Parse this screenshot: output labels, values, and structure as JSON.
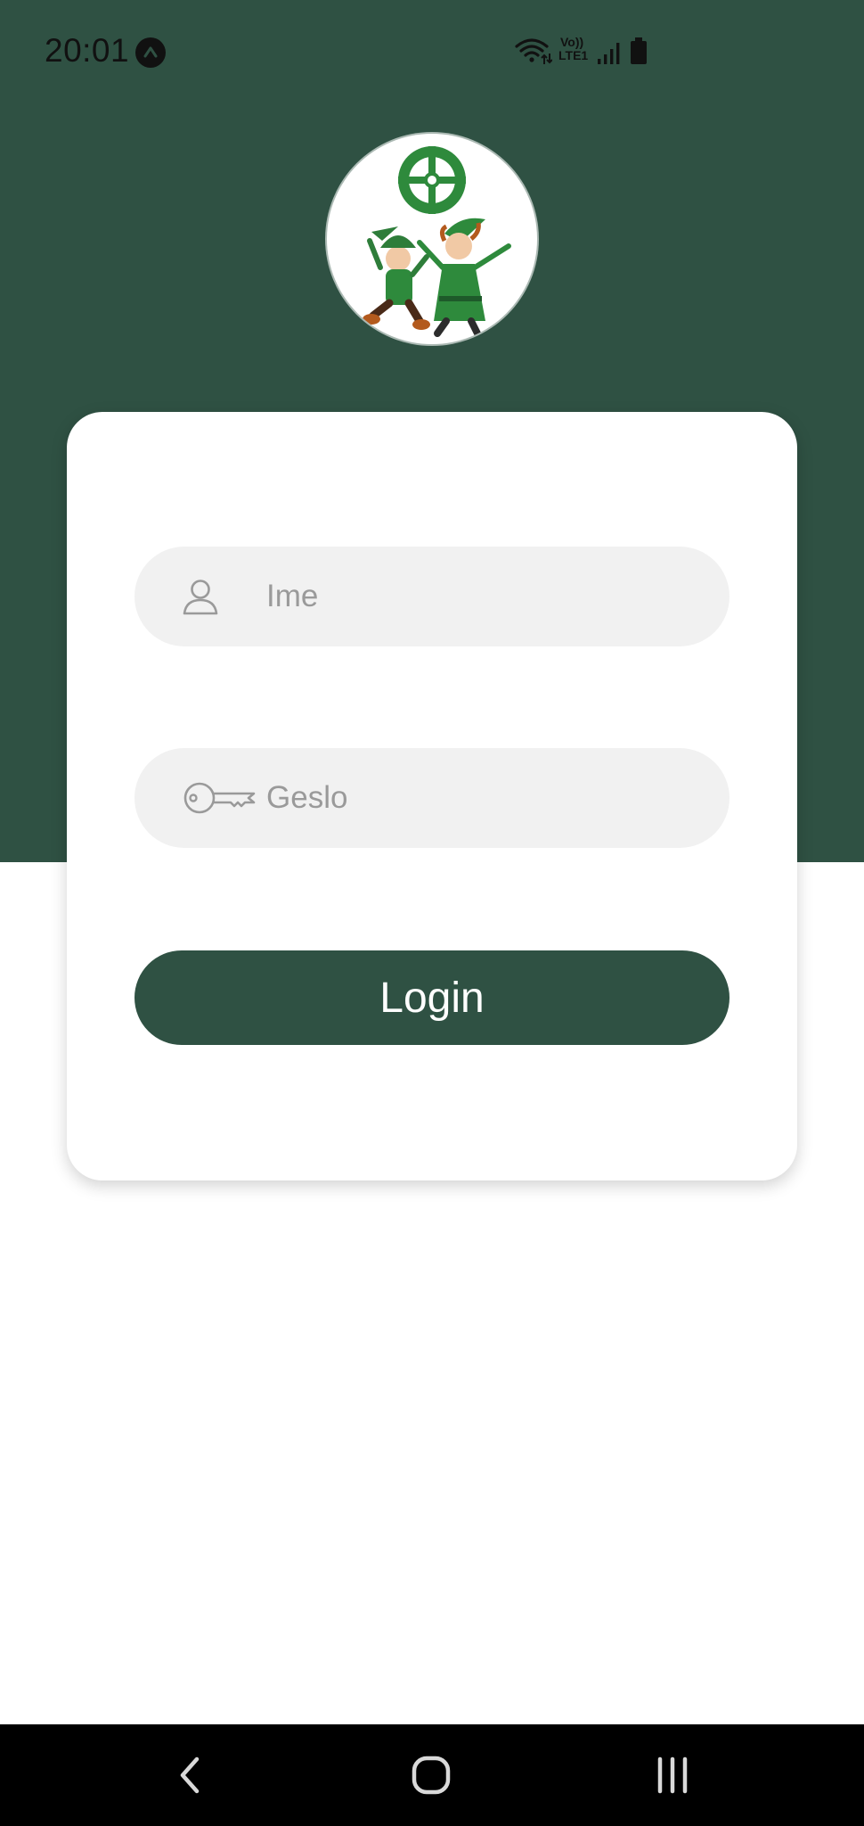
{
  "status_bar": {
    "time": "20:01",
    "icons": [
      "app-notification-icon",
      "wifi-icon",
      "volte-lte-icon",
      "signal-icon",
      "battery-icon"
    ],
    "volte_label_top": "Vo))",
    "volte_label_bottom": "LTE1"
  },
  "logo": {
    "icon": "elf-characters-logo"
  },
  "login_form": {
    "username": {
      "placeholder": "Ime",
      "value": "",
      "icon": "user-icon"
    },
    "password": {
      "placeholder": "Geslo",
      "value": "",
      "icon": "key-icon"
    },
    "submit_label": "Login"
  },
  "nav_bar": {
    "icons": [
      "back-icon",
      "home-icon",
      "recents-icon"
    ]
  },
  "colors": {
    "brand": "#2f5143",
    "field_bg": "#f1f1f1",
    "placeholder": "#9a9a9a",
    "card_bg": "#ffffff"
  }
}
